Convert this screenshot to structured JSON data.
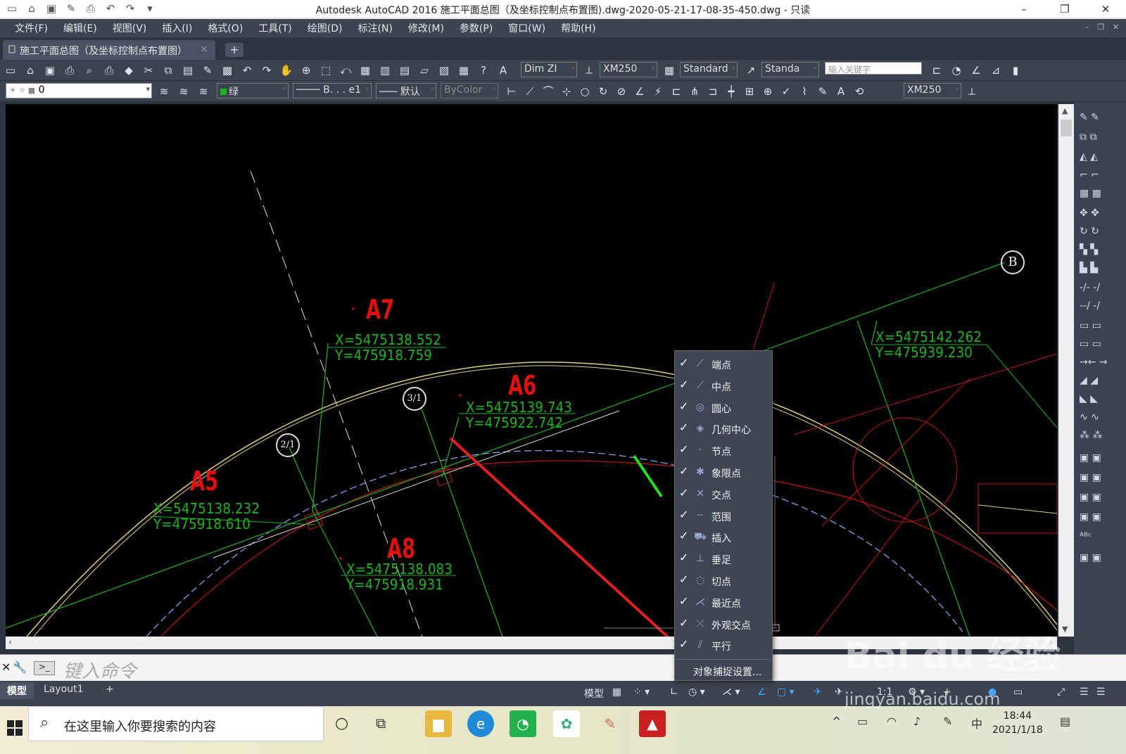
{
  "window": {
    "title": "Autodesk AutoCAD 2016    施工平面总图（及坐标控制点布置图).dwg-2020-05-21-17-08-35-450.dwg - 只读"
  },
  "menubar": [
    "文件(F)",
    "编辑(E)",
    "视图(V)",
    "插入(I)",
    "格式(O)",
    "工具(T)",
    "绘图(D)",
    "标注(N)",
    "修改(M)",
    "参数(P)",
    "窗口(W)",
    "帮助(H)"
  ],
  "doc_tab": {
    "label": "施工平面总图（及坐标控制点布置图）",
    "close": "×",
    "new_tab": "+"
  },
  "toolbar1": {
    "dim_style": "Dim ZI",
    "text_style": "XM250",
    "table_style": "Standard",
    "mleader_style": "Standa",
    "search_placeholder": "输入关键字"
  },
  "toolbar2": {
    "layer": "0",
    "color": "绿",
    "linetype": "B. . . e1",
    "lineweight": "默认",
    "plotstyle": "ByColor",
    "dim_style2": "XM250"
  },
  "drawing": {
    "points": [
      {
        "name": "A7",
        "x": "X=5475138.552",
        "y": "Y=475918.759"
      },
      {
        "name": "A6",
        "x": "X=5475139.743",
        "y": "Y=475922.742"
      },
      {
        "name": "A5",
        "x": "X=5475138.232",
        "y": "Y=475918.610"
      },
      {
        "name": "A8",
        "x": "X=5475138.083",
        "y": "Y=475918.931"
      },
      {
        "name": "",
        "x": "X=5475142.262",
        "y": "Y=475939.230"
      }
    ],
    "bubbles": [
      "B",
      "3/1",
      "2/1"
    ]
  },
  "snap_menu": {
    "items": [
      {
        "label": "端点",
        "icon": "endpoint-icon",
        "glyph": "⟋"
      },
      {
        "label": "中点",
        "icon": "midpoint-icon",
        "glyph": "⟋"
      },
      {
        "label": "圆心",
        "icon": "center-icon",
        "glyph": "◎"
      },
      {
        "label": "几何中心",
        "icon": "geometric-center-icon",
        "glyph": "◈"
      },
      {
        "label": "节点",
        "icon": "node-icon",
        "glyph": "·"
      },
      {
        "label": "象限点",
        "icon": "quadrant-icon",
        "glyph": "✱"
      },
      {
        "label": "交点",
        "icon": "intersection-icon",
        "glyph": "✕"
      },
      {
        "label": "范围",
        "icon": "extension-icon",
        "glyph": "┄"
      },
      {
        "label": "插入",
        "icon": "insertion-icon",
        "glyph": "⛟"
      },
      {
        "label": "垂足",
        "icon": "perpendicular-icon",
        "glyph": "⊥"
      },
      {
        "label": "切点",
        "icon": "tangent-icon",
        "glyph": "◌"
      },
      {
        "label": "最近点",
        "icon": "nearest-icon",
        "glyph": "⋌"
      },
      {
        "label": "外观交点",
        "icon": "apparent-intersection-icon",
        "glyph": "⤫"
      },
      {
        "label": "平行",
        "icon": "parallel-icon",
        "glyph": "⫽"
      }
    ],
    "checkmark": "✓",
    "settings_label": "对象捕捉设置..."
  },
  "command_line": {
    "placeholder": "键入命令",
    "prompt": ">_"
  },
  "layout_tabs": [
    "模型",
    "Layout1",
    "+"
  ],
  "status": {
    "model_label": "模型",
    "scale": "1:1"
  },
  "taskbar": {
    "search_placeholder": "在这里输入你要搜索的内容",
    "time": "18:44",
    "date": "2021/1/18",
    "ime": "中"
  },
  "watermark": {
    "main": "Bai du 经验",
    "sub": "jingyan.baidu.com"
  },
  "colors": {
    "canvas": "#000000",
    "coord_text": "#1fb21f",
    "point_label": "#e01010",
    "menu_bg": "#3e4554",
    "ui_dark": "#3c4350"
  }
}
